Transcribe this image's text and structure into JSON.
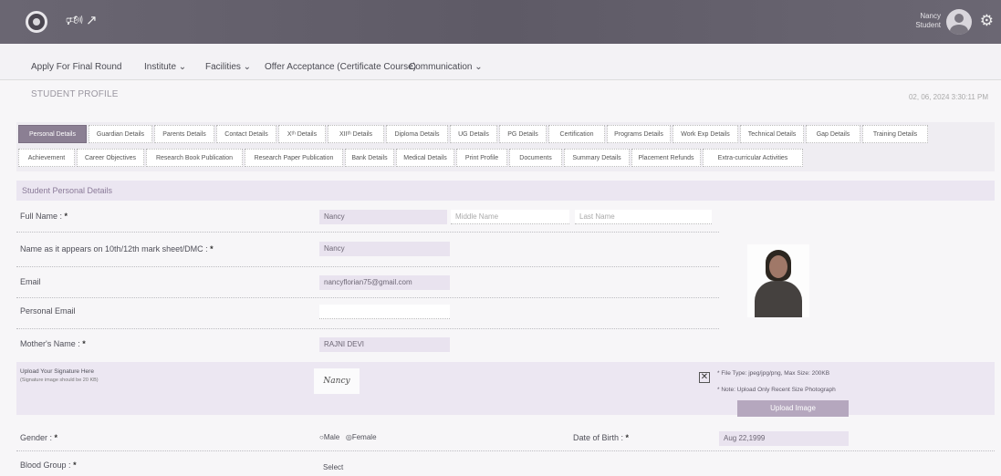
{
  "topbar": {
    "user_name_line1": "Nancy",
    "user_name_line2": "Student",
    "icons": [
      "logo",
      "megaphone-icon",
      "external-link-icon",
      "avatar",
      "gear-icon"
    ]
  },
  "menu": {
    "items": [
      "Apply For Final Round",
      "Institute ⌄",
      "Facilities ⌄",
      "Offer Acceptance (Certificate Course)",
      "Communication ⌄"
    ]
  },
  "page": {
    "title": "STUDENT PROFILE",
    "datetime": "02, 06, 2024  3:30:11 PM"
  },
  "tabs": {
    "row1": [
      "Personal Details",
      "Guardian Details",
      "Parents Details",
      "Contact Details",
      "Xᵗʰ Details",
      "XIIᵗʰ Details",
      "Diploma Details",
      "UG Details",
      "PG Details",
      "Certification",
      "Programs Details",
      "Work Exp Details",
      "Technical Details",
      "Gap Details",
      "Training Details"
    ],
    "row2": [
      "Achievement",
      "Career Objectives",
      "Research Book Publication",
      "Research Paper Publication",
      "Bank Details",
      "Medical Details",
      "Print Profile",
      "Documents",
      "Summary Details",
      "Placement Refunds",
      "Extra-curricular Activities"
    ],
    "active_index": 0
  },
  "section": {
    "title": "Student Personal Details"
  },
  "form": {
    "full_name_label": "Full Name :",
    "full_name_first": "Nancy",
    "full_name_middle": "Middle Name",
    "full_name_last": "Last Name",
    "name_as_label": "Name as it appears on 10th/12th mark sheet/DMC :",
    "name_as_value": "Nancy",
    "email_label": "Email",
    "email_value": "nancyflorian75@gmail.com",
    "personal_email_label": "Personal Email",
    "personal_email_value": "",
    "mother_label": "Mother's Name :",
    "mother_value": "RAJNI DEVI",
    "signature_label": "Upload Your Signature Here",
    "signature_sublabel": "(Signature image should be 20 KB)",
    "signature_text": "Nancy",
    "note1": "* File Type: jpeg/jpg/png, Max Size: 200KB",
    "note2": "* Note: Upload Only Recent Size Photograph",
    "upload_button": "Upload Image",
    "gender_label": "Gender :",
    "gender_male": "Male",
    "gender_female": "Female",
    "dob_label": "Date of Birth :",
    "dob_value": "Aug 22,1999",
    "blood_label": "Blood Group :",
    "blood_value": "Select",
    "required_mark": "*"
  }
}
